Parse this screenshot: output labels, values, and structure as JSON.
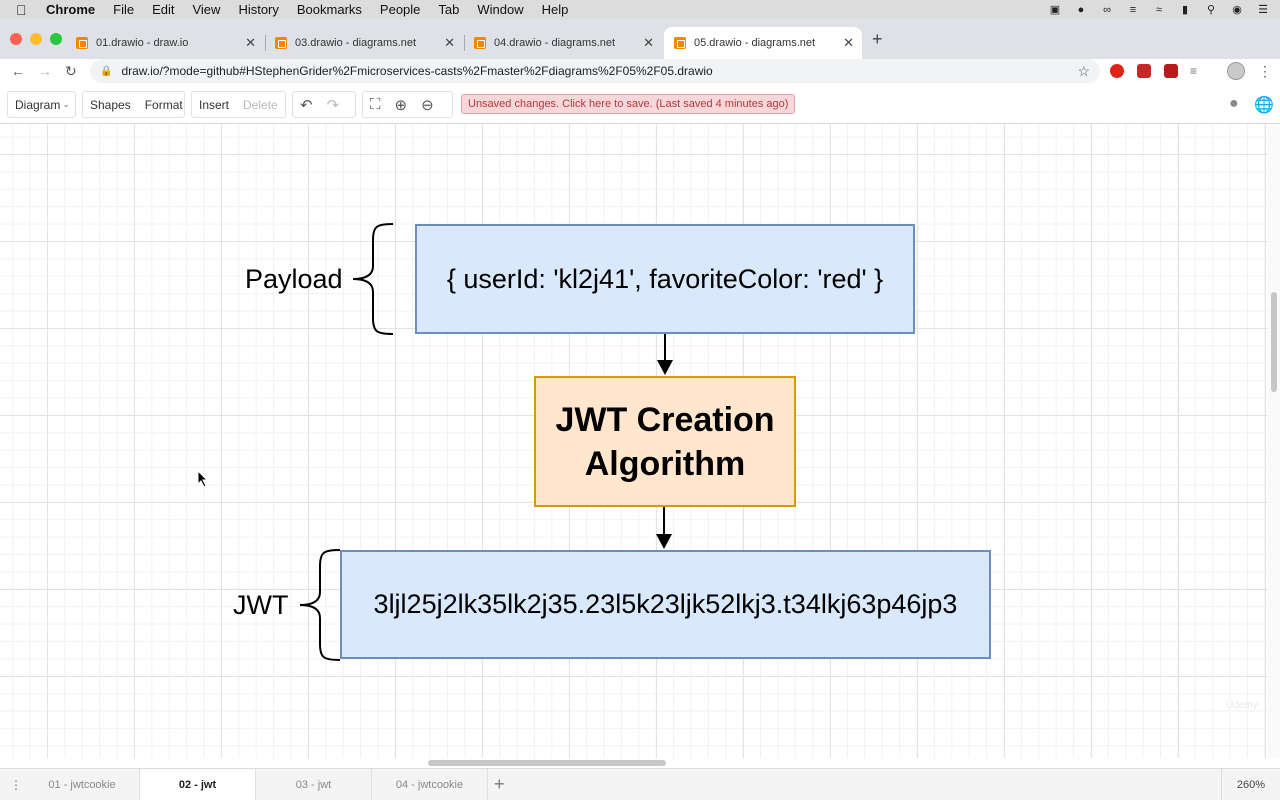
{
  "menubar": {
    "app": "Chrome",
    "items": [
      "File",
      "Edit",
      "View",
      "History",
      "Bookmarks",
      "People",
      "Tab",
      "Window",
      "Help"
    ]
  },
  "tabs": [
    {
      "title": "01.drawio - draw.io",
      "active": false
    },
    {
      "title": "03.drawio - diagrams.net",
      "active": false
    },
    {
      "title": "04.drawio - diagrams.net",
      "active": false
    },
    {
      "title": "05.drawio - diagrams.net",
      "active": true
    }
  ],
  "address": {
    "url": "draw.io/?mode=github#HStephenGrider%2Fmicroservices-casts%2Fmaster%2Fdiagrams%2F05%2F05.drawio"
  },
  "toolbar": {
    "diagram_label": "Diagram",
    "shapes_label": "Shapes",
    "format_label": "Format",
    "insert_label": "Insert",
    "delete_label": "Delete",
    "unsaved_message": "Unsaved changes. Click here to save. (Last saved 4 minutes ago)"
  },
  "diagram": {
    "payload_label": "Payload",
    "payload_text": "{ userId: 'kl2j41', favoriteColor: 'red' }",
    "algorithm_line1": "JWT Creation",
    "algorithm_line2": "Algorithm",
    "jwt_label": "JWT",
    "jwt_text": "3ljl25j2lk35lk2j35.23l5k23ljk52lkj3.t34lkj63p46jp3",
    "colors": {
      "blue_fill": "#dae8fc",
      "blue_stroke": "#6c8ebf",
      "orange_fill": "#ffe6cc",
      "orange_stroke": "#d79b00"
    }
  },
  "watermark": "Udemy",
  "pages": [
    {
      "label": "01 - jwtcookie",
      "active": false
    },
    {
      "label": "02 - jwt",
      "active": true
    },
    {
      "label": "03 - jwt",
      "active": false
    },
    {
      "label": "04 - jwtcookie",
      "active": false
    }
  ],
  "zoom": "260%"
}
